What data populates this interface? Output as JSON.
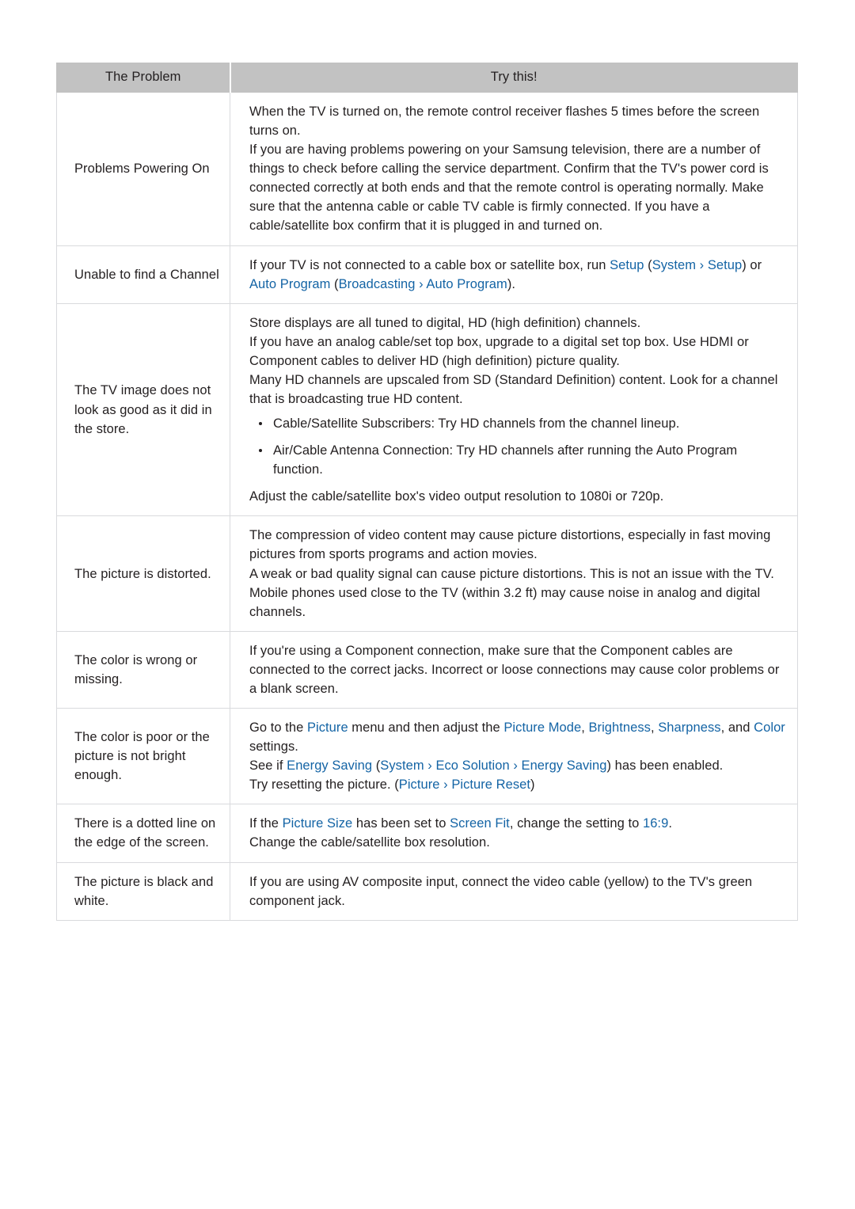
{
  "table": {
    "headers": {
      "problem": "The Problem",
      "solution": "Try this!"
    },
    "rows": [
      {
        "problem": "Problems Powering On",
        "lines": [
          "When the TV is turned on, the remote control receiver flashes 5 times before the screen turns on.",
          "If you are having problems powering on your Samsung television, there are a number of things to check before calling the service department. Confirm that the TV's power cord is connected correctly at both ends and that the remote control is operating normally. Make sure that the antenna cable or cable TV cable is firmly connected. If you have a cable/satellite box confirm that it is plugged in and turned on."
        ]
      },
      {
        "problem": "Unable to find a Channel",
        "segments": [
          {
            "t": "If your TV is not connected to a cable box or satellite box, run ",
            "c": "plain"
          },
          {
            "t": "Setup",
            "c": "blue"
          },
          {
            "t": " (",
            "c": "plain"
          },
          {
            "t": "System",
            "c": "blue"
          },
          {
            "t": " › ",
            "c": "blue"
          },
          {
            "t": "Setup",
            "c": "blue"
          },
          {
            "t": ") or ",
            "c": "plain"
          },
          {
            "t": "Auto Program",
            "c": "blue"
          },
          {
            "t": " (",
            "c": "plain"
          },
          {
            "t": "Broadcasting",
            "c": "blue"
          },
          {
            "t": " › ",
            "c": "blue"
          },
          {
            "t": "Auto Program",
            "c": "blue"
          },
          {
            "t": ").",
            "c": "plain"
          }
        ]
      },
      {
        "problem": "The TV image does not look as good as it did in the store.",
        "lines": [
          "Store displays are all tuned to digital, HD (high definition) channels.",
          "If you have an analog cable/set top box, upgrade to a digital set top box. Use HDMI or Component cables to deliver HD (high definition) picture quality.",
          "Many HD channels are upscaled from SD (Standard Definition) content. Look for a channel that is broadcasting true HD content."
        ],
        "bullets": [
          "Cable/Satellite Subscribers: Try HD channels from the channel lineup.",
          "Air/Cable Antenna Connection: Try HD channels after running the Auto Program function."
        ],
        "lines_after": [
          "Adjust the cable/satellite box's video output resolution to 1080i or 720p."
        ]
      },
      {
        "problem": "The picture is distorted.",
        "lines": [
          "The compression of video content may cause picture distortions, especially in fast moving pictures from sports programs and action movies.",
          "A weak or bad quality signal can cause picture distortions. This is not an issue with the TV.",
          "Mobile phones used close to the TV (within 3.2 ft) may cause noise in analog and digital channels."
        ]
      },
      {
        "problem": "The color is wrong or missing.",
        "lines": [
          "If you're using a Component connection, make sure that the Component cables are connected to the correct jacks. Incorrect or loose connections may cause color problems or a blank screen."
        ]
      },
      {
        "problem": "The color is poor or the picture is not bright enough.",
        "paragraphs": [
          [
            {
              "t": "Go to the ",
              "c": "plain"
            },
            {
              "t": "Picture",
              "c": "blue"
            },
            {
              "t": " menu and then adjust the ",
              "c": "plain"
            },
            {
              "t": "Picture Mode",
              "c": "blue"
            },
            {
              "t": ", ",
              "c": "plain"
            },
            {
              "t": "Brightness",
              "c": "blue"
            },
            {
              "t": ", ",
              "c": "plain"
            },
            {
              "t": "Sharpness",
              "c": "blue"
            },
            {
              "t": ", and ",
              "c": "plain"
            },
            {
              "t": "Color",
              "c": "blue"
            },
            {
              "t": " settings.",
              "c": "plain"
            }
          ],
          [
            {
              "t": "See if ",
              "c": "plain"
            },
            {
              "t": "Energy Saving",
              "c": "blue"
            },
            {
              "t": " (",
              "c": "plain"
            },
            {
              "t": "System",
              "c": "blue"
            },
            {
              "t": " › ",
              "c": "blue"
            },
            {
              "t": "Eco Solution",
              "c": "blue"
            },
            {
              "t": " › ",
              "c": "blue"
            },
            {
              "t": "Energy Saving",
              "c": "blue"
            },
            {
              "t": ") has been enabled.",
              "c": "plain"
            }
          ],
          [
            {
              "t": "Try resetting the picture. (",
              "c": "plain"
            },
            {
              "t": "Picture",
              "c": "blue"
            },
            {
              "t": " › ",
              "c": "blue"
            },
            {
              "t": "Picture Reset",
              "c": "blue"
            },
            {
              "t": ")",
              "c": "plain"
            }
          ]
        ]
      },
      {
        "problem": "There is a dotted line on the edge of the screen.",
        "paragraphs": [
          [
            {
              "t": "If the ",
              "c": "plain"
            },
            {
              "t": "Picture Size",
              "c": "blue"
            },
            {
              "t": " has been set to ",
              "c": "plain"
            },
            {
              "t": "Screen Fit",
              "c": "blue"
            },
            {
              "t": ", change the setting to ",
              "c": "plain"
            },
            {
              "t": "16:9",
              "c": "blue"
            },
            {
              "t": ".",
              "c": "plain"
            }
          ],
          [
            {
              "t": "Change the cable/satellite box resolution.",
              "c": "plain"
            }
          ]
        ]
      },
      {
        "problem": "The picture is black and white.",
        "lines": [
          "If you are using AV composite input, connect the video cable (yellow) to the TV's green component jack."
        ]
      }
    ]
  },
  "colors": {
    "link_blue": "#1464a5",
    "header_bg": "#c2c2c2",
    "border": "#d9dadd",
    "text": "#231f20"
  }
}
